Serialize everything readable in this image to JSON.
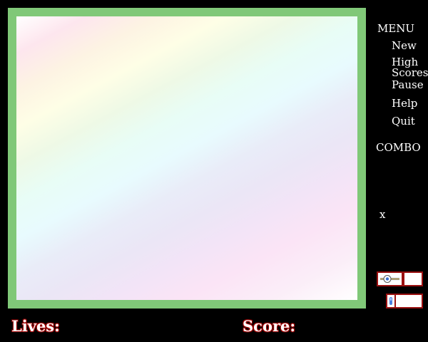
{
  "menu": {
    "title": "MENU",
    "items": [
      {
        "label": "New"
      },
      {
        "label": "High Scores"
      },
      {
        "label": "Pause"
      },
      {
        "label": "Help"
      },
      {
        "label": "Quit"
      }
    ]
  },
  "combo_label": "COMBO",
  "multiplier_label": "x",
  "hud": {
    "lives_label": "Lives:",
    "score_label": "Score:"
  },
  "icons": {
    "speed_control": "slider-icon",
    "volume_control": "volume-slider-icon"
  },
  "colors": {
    "background": "#000000",
    "board_border": "#80c878",
    "control_border": "#9a1010",
    "hud_text_outline": "#a00000"
  }
}
